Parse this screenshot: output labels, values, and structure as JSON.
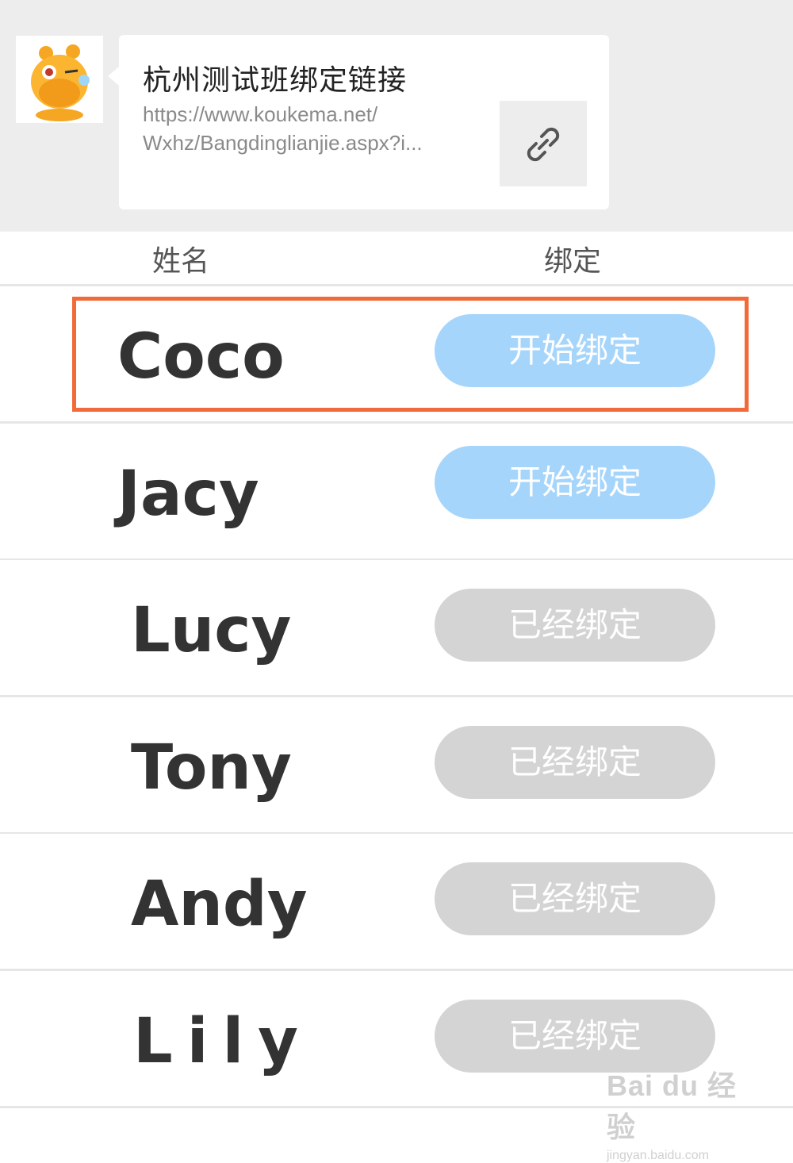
{
  "message": {
    "title": "杭州测试班绑定链接",
    "url_line1": "https://www.koukema.net/",
    "url_line2": "Wxhz/Bangdinglianjie.aspx?i...",
    "link_icon": "link-icon"
  },
  "table": {
    "headers": {
      "name": "姓名",
      "bind": "绑定"
    },
    "rows": [
      {
        "name": "Coco",
        "button": "开始绑定",
        "status": "start"
      },
      {
        "name": "Jacy",
        "button": "开始绑定",
        "status": "start"
      },
      {
        "name": "Lucy",
        "button": "已经绑定",
        "status": "done"
      },
      {
        "name": "Tony",
        "button": "已经绑定",
        "status": "done"
      },
      {
        "name": "Andy",
        "button": "已经绑定",
        "status": "done"
      },
      {
        "name": "Lily",
        "button": "已经绑定",
        "status": "done"
      }
    ]
  },
  "watermark": {
    "main": "Bai du 经验",
    "sub": "jingyan.baidu.com"
  },
  "colors": {
    "start_button": "#a6d5fb",
    "bound_button": "#d4d4d4",
    "highlight": "#f06a3a"
  }
}
